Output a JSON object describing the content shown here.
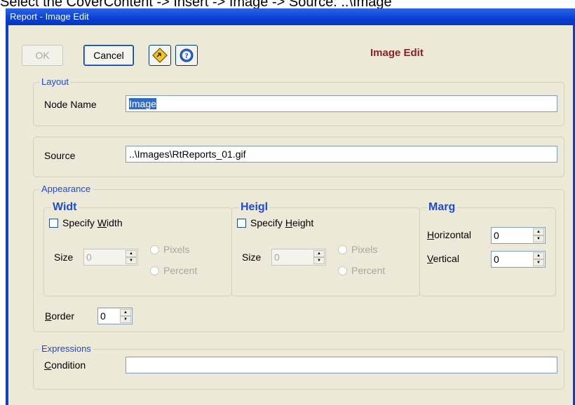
{
  "doc_caption": "Select the CoverContent -> Insert -> Image -> Source: ..\\Image",
  "window": {
    "title": "Report - Image Edit"
  },
  "toolbar": {
    "ok_label": "OK",
    "cancel_label": "Cancel",
    "heading": "Image Edit",
    "ok_enabled": false
  },
  "layout": {
    "legend": "Layout",
    "node_name_label": "Node Name",
    "node_name_value": "Image"
  },
  "source": {
    "label": "Source",
    "value": "..\\Images\\RtReports_01.gif"
  },
  "appearance": {
    "legend": "Appearance",
    "width": {
      "heading": "Widt",
      "specify_label": "Specify Width",
      "specify_checked": false,
      "size_label": "Size",
      "size_value": "0",
      "pixels_label": "Pixels",
      "percent_label": "Percent"
    },
    "height": {
      "heading": "Heigl",
      "specify_label": "Specify Height",
      "specify_checked": false,
      "size_label": "Size",
      "size_value": "0",
      "pixels_label": "Pixels",
      "percent_label": "Percent"
    },
    "margin": {
      "heading": "Marg",
      "horizontal_label": "Horizontal",
      "horizontal_value": "0",
      "vertical_label": "Vertical",
      "vertical_value": "0"
    },
    "border_label": "Border",
    "border_value": "0"
  },
  "expressions": {
    "legend": "Expressions",
    "condition_label": "Condition",
    "condition_value": ""
  },
  "colors": {
    "titlebar": "#0a3fd0",
    "dialog_bg": "#ece9d8",
    "heading": "#8b2323",
    "legend": "#1c4cd0",
    "selection": "#316ac5"
  },
  "icons": [
    "wizard-icon",
    "help-icon"
  ]
}
